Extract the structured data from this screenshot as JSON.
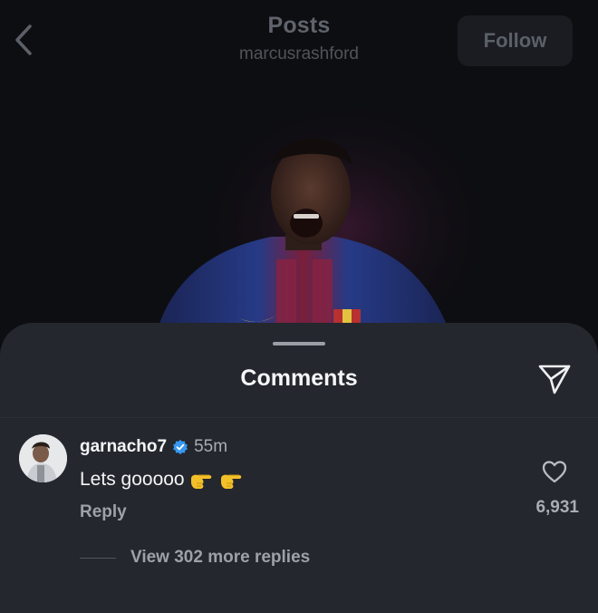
{
  "header": {
    "title": "Posts",
    "username": "marcusrashford",
    "follow_label": "Follow",
    "icons": {
      "back": "chevron-left-icon"
    }
  },
  "post": {
    "image": "player-celebration-photo"
  },
  "comments_sheet": {
    "title": "Comments",
    "icons": {
      "share": "paper-plane-icon"
    },
    "comments": [
      {
        "username": "garnacho7",
        "verified": true,
        "time": "55m",
        "text": "Lets gooooo",
        "emojis": [
          "pointing-hand-emoji",
          "pointing-hand-emoji"
        ],
        "reply_label": "Reply",
        "like_count": "6,931",
        "view_replies_label": "View 302 more replies"
      }
    ]
  },
  "colors": {
    "sheet_bg": "#24272d",
    "verified_blue": "#3897f0",
    "header_bg": "#0d0e11"
  }
}
